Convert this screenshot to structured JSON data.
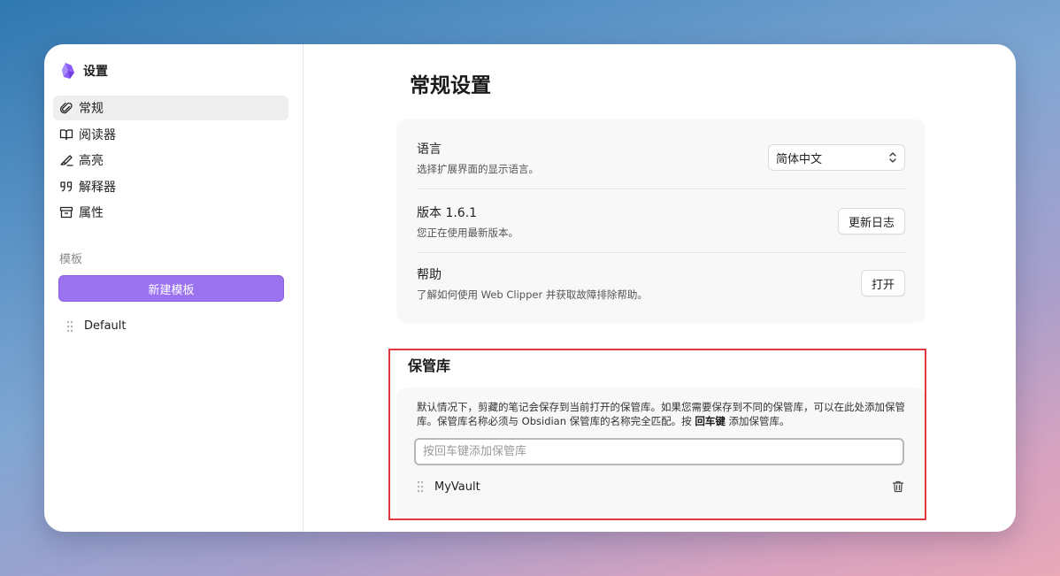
{
  "sidebar": {
    "app_title": "设置",
    "nav_items": [
      {
        "label": "常规",
        "icon": "paperclip-icon",
        "active": true
      },
      {
        "label": "阅读器",
        "icon": "book-icon",
        "active": false
      },
      {
        "label": "高亮",
        "icon": "highlighter-icon",
        "active": false
      },
      {
        "label": "解释器",
        "icon": "quote-icon",
        "active": false
      },
      {
        "label": "属性",
        "icon": "archive-icon",
        "active": false
      }
    ],
    "templates_label": "模板",
    "new_template_label": "新建模板",
    "templates": [
      {
        "name": "Default"
      }
    ]
  },
  "main": {
    "title": "常规设置",
    "settings": {
      "language": {
        "name": "语言",
        "desc": "选择扩展界面的显示语言。",
        "value": "简体中文"
      },
      "version": {
        "name": "版本 1.6.1",
        "desc": "您正在使用最新版本。",
        "button": "更新日志"
      },
      "help": {
        "name": "帮助",
        "desc": "了解如何使用 Web Clipper 并获取故障排除帮助。",
        "button": "打开"
      }
    },
    "vaults": {
      "heading": "保管库",
      "desc_part1": "默认情况下，剪藏的笔记会保存到当前打开的保管库。如果您需要保存到不同的保管库，可以在此处添加保管库。保管库名称必须与 Obsidian 保管库的名称完全匹配。按 ",
      "desc_key": "回车键",
      "desc_part2": " 添加保管库。",
      "input_placeholder": "按回车键添加保管库",
      "input_value": "",
      "items": [
        {
          "name": "MyVault"
        }
      ]
    }
  },
  "colors": {
    "accent": "#9b72ef",
    "highlight_outline": "#e0383f"
  }
}
